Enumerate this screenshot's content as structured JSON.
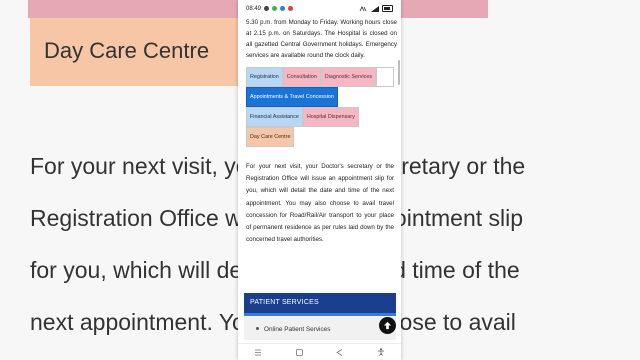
{
  "background": {
    "top_bar_color": "#e7a8b6",
    "daycare_label": "Day Care Centre",
    "para_lines": [
      "For your next visit, your Doctor's secretary or the",
      "Registration Office will issue an appointment slip",
      "for you, which will detail the date and time of the",
      "next appointment. You may also choose to avail"
    ]
  },
  "status_bar": {
    "time": "08:49",
    "icons": [
      "sim-icon",
      "whatsapp-icon",
      "app-icon",
      "notification-icon"
    ],
    "right_icons": [
      "data-icon",
      "signal-icon",
      "battery-icon"
    ]
  },
  "page": {
    "intro_text": "5.30 p.m. from Monday to Friday. Working hours close at 2.15 p.m. on Saturdays. The Hospital is closed on all gazetted Central Government holidays. Emergency services are available round the clock daily.",
    "tabs_row1": [
      "Registration",
      "Consultation",
      "Diagnostic Services"
    ],
    "tabs_row2": [
      "Appointments & Travel Concession"
    ],
    "tabs_row3": [
      "Financial Assistance",
      "Hospital Dispensary"
    ],
    "tabs_row4": [
      "Day Care Centre"
    ],
    "active_tab": "Appointments & Travel Concession",
    "appointment_text": "For your next visit, your Doctor's secretary or the Registration Office will issue an appointment slip for you, which will detail the date and time of the next appointment. You may also choose to avail travel concession for Road/Rail/Air transport to your place of permanent residence as per rules laid down by the concerned travel authorities.",
    "patient_services_heading": "PATIENT SERVICES",
    "online_services_label": "Online Patient Services"
  },
  "colors": {
    "tab_blue": "#b7d7f4",
    "tab_pink": "#f4b7c3",
    "tab_orange": "#f6c6a8",
    "tab_active": "#1a73d6",
    "services_header": "#1b3f8f"
  }
}
